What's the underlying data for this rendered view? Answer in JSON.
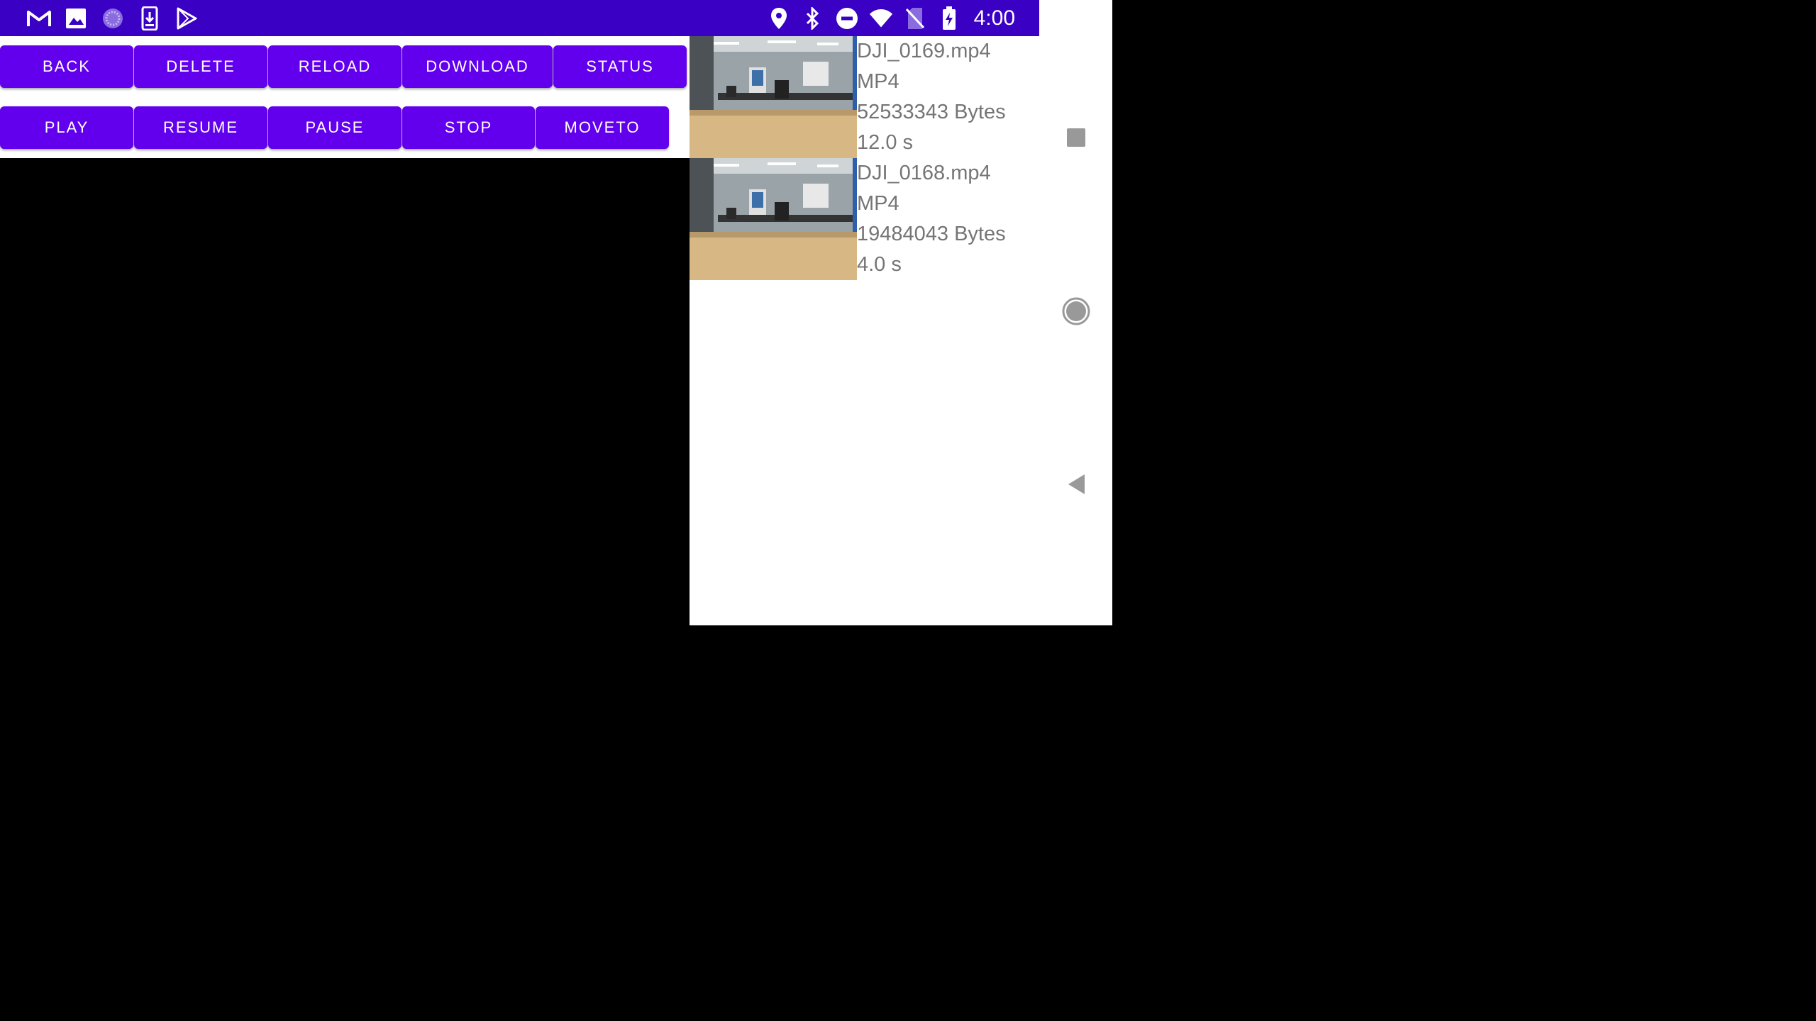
{
  "status_bar": {
    "left_icons": [
      "gmail-icon",
      "gallery-icon",
      "sync-spinner-icon",
      "download-icon",
      "play-store-icon"
    ],
    "right_icons": [
      "location-icon",
      "bluetooth-icon",
      "do-not-disturb-icon",
      "wifi-icon",
      "no-sim-icon",
      "battery-charging-icon"
    ],
    "time": "4:00",
    "bg_color": "#3a00c4"
  },
  "controls": {
    "row1": [
      "BACK",
      "DELETE",
      "RELOAD",
      "DOWNLOAD",
      "STATUS"
    ],
    "row2": [
      "PLAY",
      "RESUME",
      "PAUSE",
      "STOP",
      "MOVETO"
    ],
    "button_color": "#6200ee"
  },
  "files": [
    {
      "name": "DJI_0169.mp4",
      "type": "MP4",
      "size": "52533343 Bytes",
      "duration": "12.0 s"
    },
    {
      "name": "DJI_0168.mp4",
      "type": "MP4",
      "size": "19484043 Bytes",
      "duration": "4.0 s"
    }
  ],
  "nav_bar": {
    "icons": [
      "recents-icon",
      "home-icon",
      "back-icon"
    ]
  }
}
